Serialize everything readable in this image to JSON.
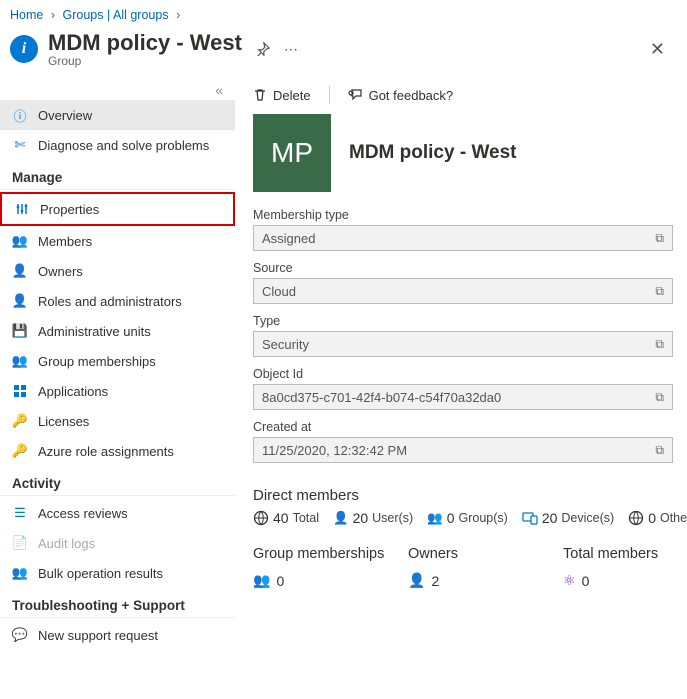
{
  "breadcrumb": {
    "home": "Home",
    "groups": "Groups | All groups"
  },
  "header": {
    "title": "MDM policy - West",
    "subtitle": "Group"
  },
  "toolbar": {
    "delete": "Delete",
    "feedback": "Got feedback?"
  },
  "sidebar": {
    "overview": "Overview",
    "diagnose": "Diagnose and solve problems",
    "manage": "Manage",
    "properties": "Properties",
    "members": "Members",
    "owners": "Owners",
    "roles": "Roles and administrators",
    "admin_units": "Administrative units",
    "group_memberships": "Group memberships",
    "applications": "Applications",
    "licenses": "Licenses",
    "azure_roles": "Azure role assignments",
    "activity": "Activity",
    "access_reviews": "Access reviews",
    "audit_logs": "Audit logs",
    "bulk_results": "Bulk operation results",
    "troubleshoot": "Troubleshooting + Support",
    "support_request": "New support request"
  },
  "tile": {
    "initials": "MP",
    "title": "MDM policy - West"
  },
  "fields": {
    "membership_type": {
      "label": "Membership type",
      "value": "Assigned"
    },
    "source": {
      "label": "Source",
      "value": "Cloud"
    },
    "type": {
      "label": "Type",
      "value": "Security"
    },
    "object_id": {
      "label": "Object Id",
      "value": "8a0cd375-c701-42f4-b074-c54f70a32da0"
    },
    "created_at": {
      "label": "Created at",
      "value": "11/25/2020, 12:32:42 PM"
    }
  },
  "direct_members": {
    "heading": "Direct members",
    "total": {
      "value": "40",
      "label": "Total"
    },
    "users": {
      "value": "20",
      "label": "User(s)"
    },
    "groups": {
      "value": "0",
      "label": "Group(s)"
    },
    "devices": {
      "value": "20",
      "label": "Device(s)"
    },
    "others": {
      "value": "0",
      "label": "Other(s)"
    }
  },
  "bottom": {
    "group_memberships": {
      "heading": "Group memberships",
      "value": "0"
    },
    "owners": {
      "heading": "Owners",
      "value": "2"
    },
    "total_members": {
      "heading": "Total members",
      "value": "0"
    }
  }
}
